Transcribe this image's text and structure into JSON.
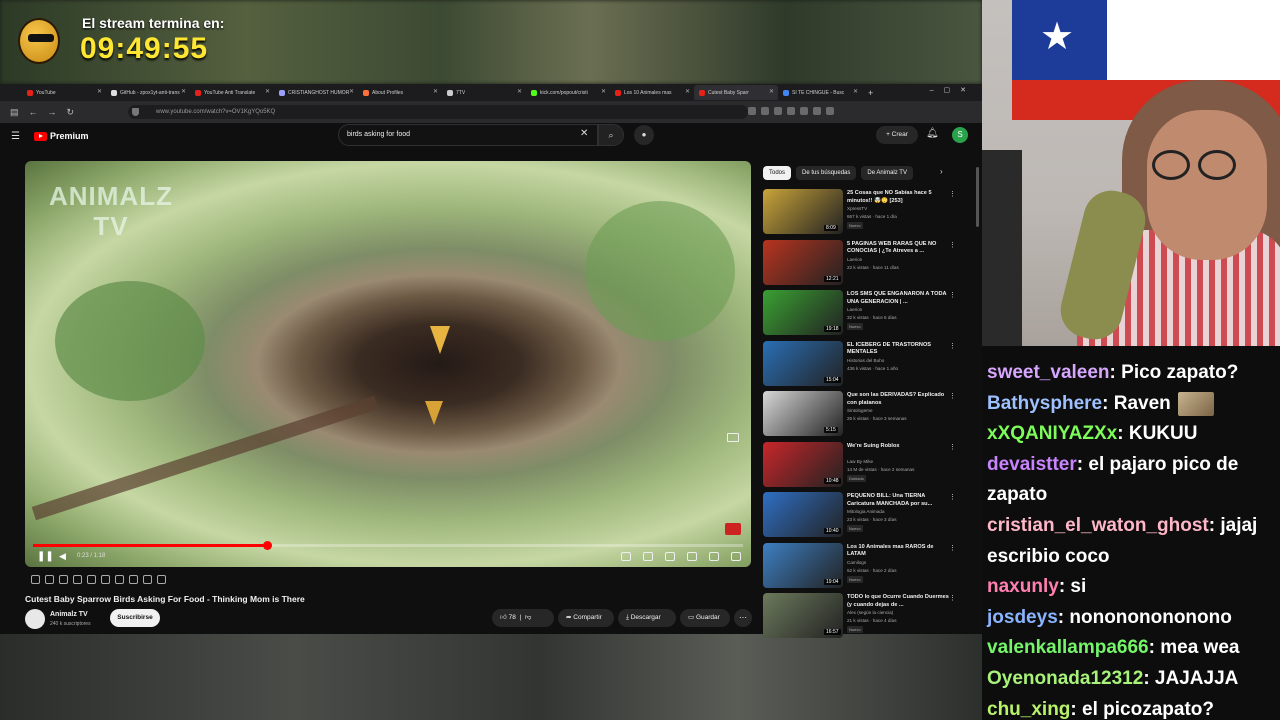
{
  "overlay": {
    "timer_label": "El stream termina en:",
    "timer_value": "09:49:55"
  },
  "browser": {
    "tabs": [
      {
        "label": "YouTube",
        "favicon_color": "#e62117"
      },
      {
        "label": "GitHub - zpox1yt-anti-trans",
        "favicon_color": "#dddddd"
      },
      {
        "label": "YouTube Anti Translate",
        "favicon_color": "#e62117"
      },
      {
        "label": "CRISTIANGHOST HUMOR",
        "favicon_color": "#9aa0ff"
      },
      {
        "label": "About Profiles",
        "favicon_color": "#ff7139"
      },
      {
        "label": "7TV",
        "favicon_color": "#cccccc"
      },
      {
        "label": "kick.com/popout/cristi",
        "favicon_color": "#53fc18"
      },
      {
        "label": "Los 10 Animales mas",
        "favicon_color": "#e62117"
      },
      {
        "label": "Cutest Baby Sparr",
        "favicon_color": "#e62117",
        "active": true
      },
      {
        "label": "SI TE CHINGUE - Busc",
        "favicon_color": "#4285f4"
      }
    ],
    "new_tab": "+",
    "url": "www.youtube.com/watch?v=OV1KgYQo5KQ"
  },
  "youtube": {
    "logo_text": "Premium",
    "search_query": "birds asking for food",
    "create_label": "Crear",
    "avatar_letter": "S",
    "player": {
      "watermark_line1": "ANIMALZ",
      "watermark_line2": "TV",
      "time": "0:23 / 1:18",
      "progress": 0.33
    },
    "video_title": "Cutest Baby Sparrow Birds Asking For Food - Thinking Mom is There",
    "channel_name": "Animalz TV",
    "channel_subs": "240 k suscriptores",
    "subscribe_label": "Suscribirse",
    "like_count": "78",
    "share_label": "Compartir",
    "download_label": "Descargar",
    "save_label": "Guardar",
    "chips": [
      "Todos",
      "De tus búsquedas",
      "De Animalz TV"
    ],
    "recommendations": [
      {
        "title": "25 Cosas que NO Sabías hace 5 minutos!! 🤯😳 [253]",
        "channel": "XpressTV",
        "meta": "667 k vistas · hace 1 día",
        "badge": "Nuevo",
        "duration": "8:09",
        "color": "#c9a43a"
      },
      {
        "title": "5 PAGINAS WEB RARAS QUE NO CONOCIAS | ¿Te Atreves a ...",
        "channel": "Laerion",
        "meta": "22 k vistas · hace 11 días",
        "badge": "",
        "duration": "12:21",
        "color": "#b8341f"
      },
      {
        "title": "LOS SMS QUE ENGAÑARON A TODA UNA GENERACION | ...",
        "channel": "Laerion",
        "meta": "32 k vistas · hace 5 días",
        "badge": "Nuevo",
        "duration": "19:18",
        "color": "#3aa032"
      },
      {
        "title": "EL ICEBERG DE TRASTORNOS MENTALES",
        "channel": "Historias del Buho",
        "meta": "436 k vistas · hace 1 año",
        "badge": "",
        "duration": "15:04",
        "color": "#2a6fb5"
      },
      {
        "title": "Que son las DERIVADAS? Explicado con platanos",
        "channel": "Sintologeme",
        "meta": "25 k vistas · hace 3 semanas",
        "badge": "",
        "duration": "5:15",
        "color": "#d8d8d8"
      },
      {
        "title": "We're Suing Roblox",
        "channel": "Law By Mike",
        "meta": "14 M de vistas · hace 2 semanas",
        "badge": "Doblado",
        "duration": "10:48",
        "color": "#c8262a"
      },
      {
        "title": "PEQUEÑO BILL: Una TIERNA Caricatura MANCHADA por su...",
        "channel": "Mitologia Animada",
        "meta": "23 k vistas · hace 3 días",
        "badge": "Nuevo",
        "duration": "10:40",
        "color": "#2f6fc4"
      },
      {
        "title": "Los 10 Animales mas RAROS de LATAM",
        "channel": "Camilogs",
        "meta": "52 k vistas · hace 2 días",
        "badge": "Nuevo",
        "duration": "19:04",
        "color": "#3d7fc2"
      },
      {
        "title": "TODO lo que Ocurre Cuando Duermes (y cuando dejas de ...",
        "channel": "Alex (según la ciencia)",
        "meta": "21 k vistas · hace 4 días",
        "badge": "Nuevo",
        "duration": "16:57",
        "color": "#6c7a5c"
      }
    ]
  },
  "chat": [
    {
      "user": "sweet_valeen",
      "color": "#d6a6ff",
      "text": "Pico zapato?"
    },
    {
      "user": "Bathysphere",
      "color": "#9ec0ff",
      "text": "Raven",
      "emote": true
    },
    {
      "user": "xXQANIYAZXx",
      "color": "#7dfc5a",
      "text": "KUKUU"
    },
    {
      "user": "devaistter",
      "color": "#c883ff",
      "text": "el pajaro pico de zapato"
    },
    {
      "user": "cristian_el_waton_ghost",
      "color": "#ffb7c8",
      "text": "jajaj escribio coco"
    },
    {
      "user": "naxunly",
      "color": "#ff80b0",
      "text": "si"
    },
    {
      "user": "josdeys",
      "color": "#8ab4ff",
      "text": "nonononononono"
    },
    {
      "user": "valenkallampa666",
      "color": "#75f56a",
      "text": "mea wea"
    },
    {
      "user": "Oyenonada12312",
      "color": "#a8f27a",
      "text": "JAJAJJA"
    },
    {
      "user": "chu_xing",
      "color": "#b8f26a",
      "text": "el picozapato?"
    }
  ]
}
